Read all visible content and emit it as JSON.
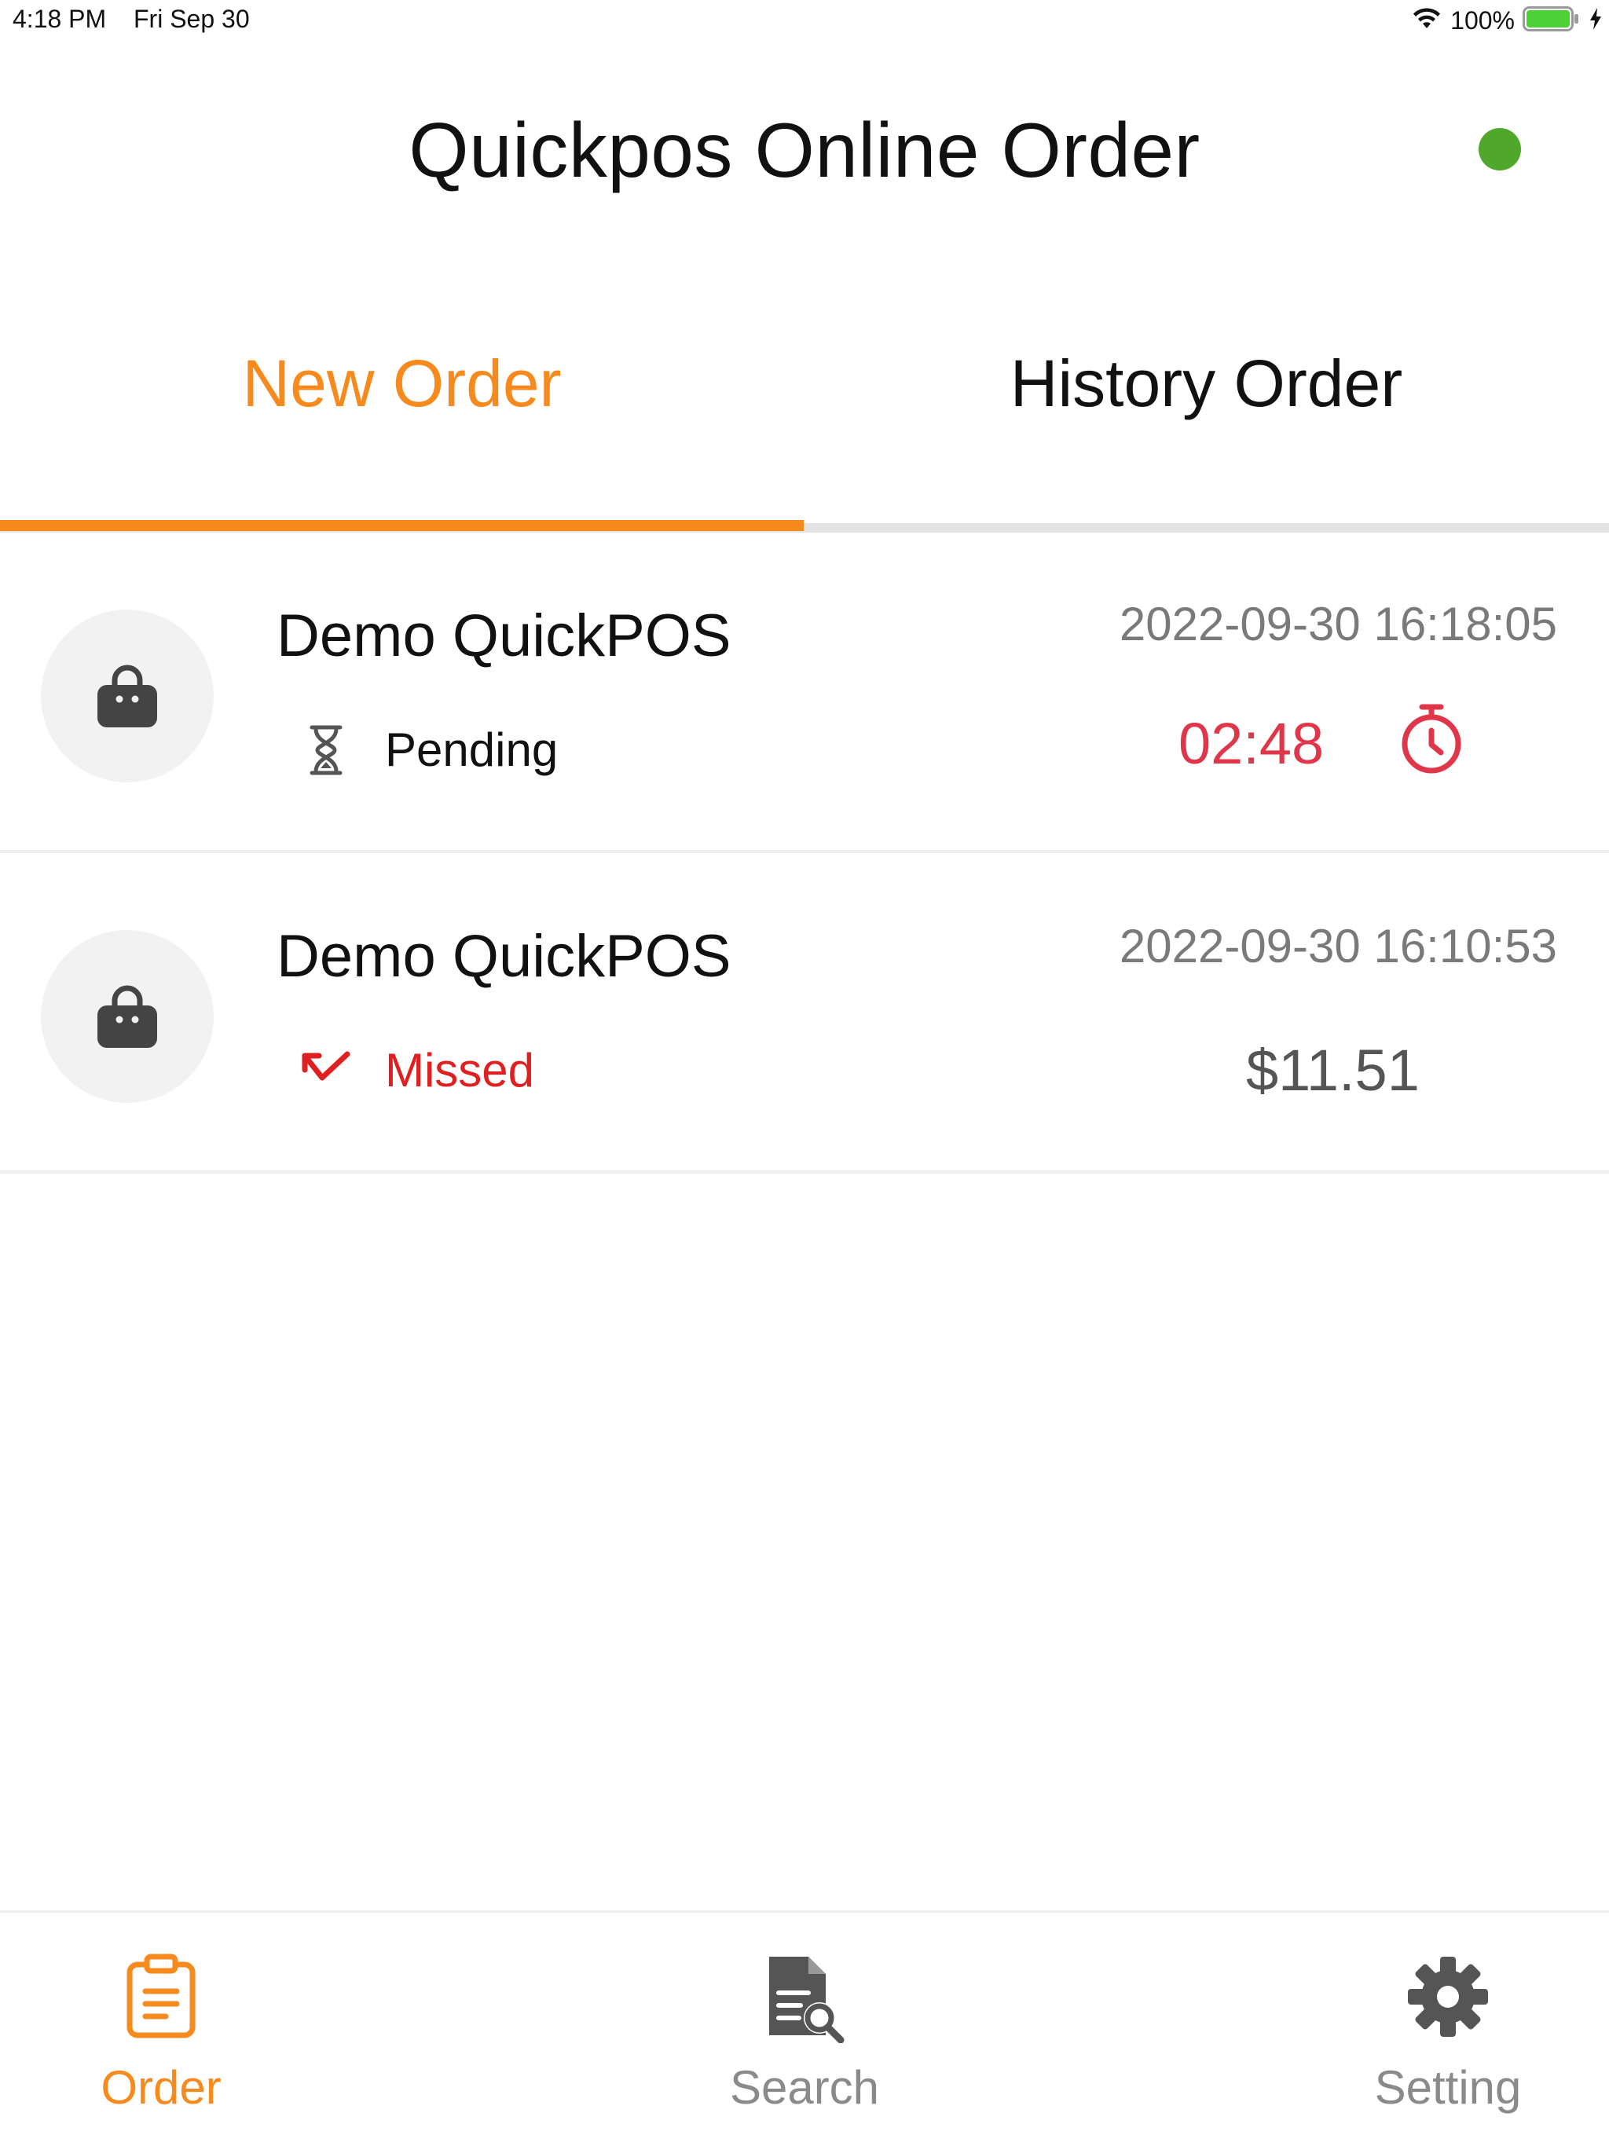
{
  "status_bar": {
    "time": "4:18 PM",
    "date": "Fri Sep 30",
    "battery_text": "100%"
  },
  "header": {
    "title": "Quickpos Online Order",
    "online_status_color": "#4fa82a"
  },
  "tabs": [
    {
      "label": "New Order",
      "active": true
    },
    {
      "label": "History Order",
      "active": false
    }
  ],
  "orders": [
    {
      "store": "Demo QuickPOS",
      "datetime": "2022-09-30 16:18:05",
      "status": "Pending",
      "status_icon": "hourglass-icon",
      "countdown": "02:48",
      "countdown_icon": "stopwatch-icon"
    },
    {
      "store": "Demo QuickPOS",
      "datetime": "2022-09-30 16:10:53",
      "status": "Missed",
      "status_icon": "missed-arrow-icon",
      "amount": "$11.51"
    }
  ],
  "bottom_nav": [
    {
      "label": "Order",
      "icon": "clipboard-icon",
      "active": true
    },
    {
      "label": "Search",
      "icon": "document-search-icon",
      "active": false
    },
    {
      "label": "Setting",
      "icon": "gear-icon",
      "active": false
    }
  ],
  "colors": {
    "accent": "#f78a1d",
    "countdown": "#e0364a",
    "missed": "#e02020"
  }
}
